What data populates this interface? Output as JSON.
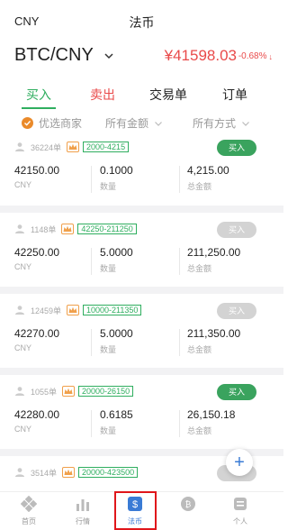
{
  "header": {
    "currency": "CNY",
    "title": "法币"
  },
  "market": {
    "pair": "BTC/CNY",
    "price": "¥41598.03",
    "change": "-0.68%"
  },
  "tabs": [
    "买入",
    "卖出",
    "交易单",
    "订单"
  ],
  "filters": [
    "优选商家",
    "所有金额",
    "所有方式"
  ],
  "listings": [
    {
      "orders": "36224单",
      "range": "2000-4215",
      "buy": "买入",
      "buy_enabled": true,
      "price": "42150.00",
      "price_unit": "CNY",
      "qty": "0.1000",
      "qty_label": "数量",
      "total": "4,215.00",
      "total_label": "总金额"
    },
    {
      "orders": "1148单",
      "range": "42250-211250",
      "buy": "买入",
      "buy_enabled": false,
      "price": "42250.00",
      "price_unit": "CNY",
      "qty": "5.0000",
      "qty_label": "数量",
      "total": "211,250.00",
      "total_label": "总金额"
    },
    {
      "orders": "12459单",
      "range": "10000-211350",
      "buy": "买入",
      "buy_enabled": false,
      "price": "42270.00",
      "price_unit": "CNY",
      "qty": "5.0000",
      "qty_label": "数量",
      "total": "211,350.00",
      "total_label": "总金额"
    },
    {
      "orders": "1055单",
      "range": "20000-26150",
      "buy": "买入",
      "buy_enabled": true,
      "price": "42280.00",
      "price_unit": "CNY",
      "qty": "0.6185",
      "qty_label": "数量",
      "total": "26,150.18",
      "total_label": "总金额"
    },
    {
      "orders": "3514单",
      "range": "20000-423500"
    }
  ],
  "bottom_nav": [
    "首页",
    "行情",
    "法币",
    "",
    "个人"
  ],
  "colors": {
    "buy_green": "#2fae5f",
    "sell_red": "#e94a4a",
    "accent_blue": "#3a7bd5",
    "highlight": "#e0161b"
  }
}
